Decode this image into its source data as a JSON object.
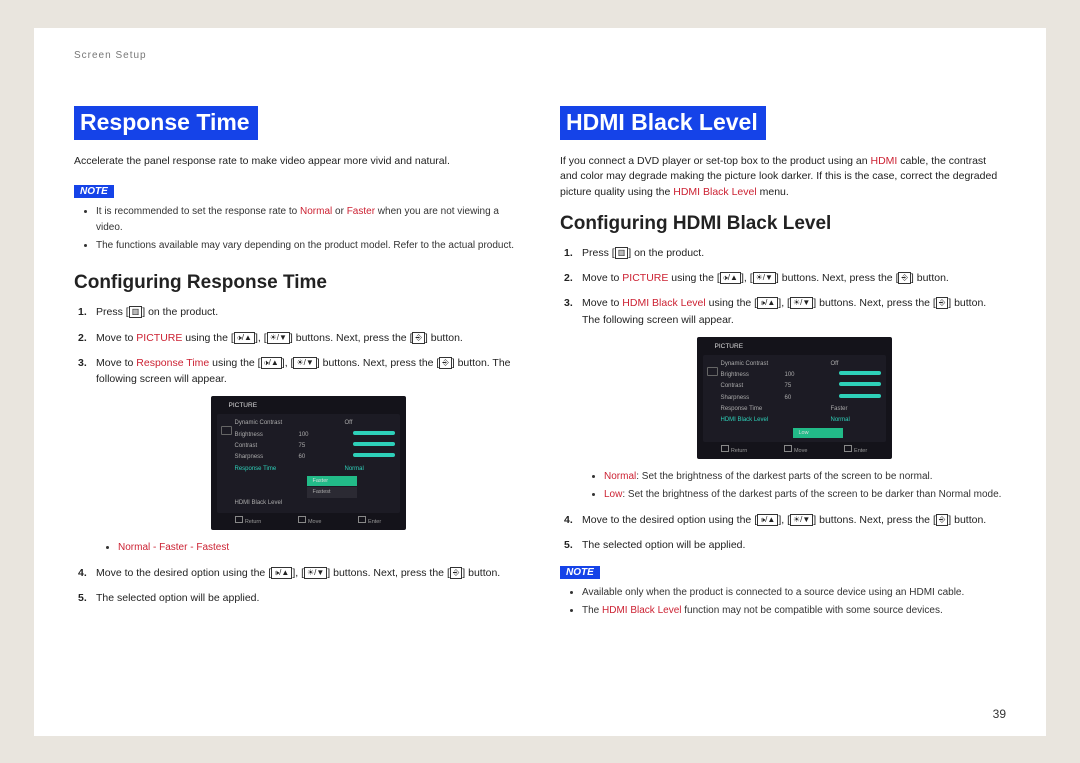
{
  "header": "Screen Setup",
  "pageNumber": "39",
  "left": {
    "title": "Response Time",
    "intro": "Accelerate the panel response rate to make video appear more vivid and natural.",
    "noteLabel": "NOTE",
    "notes": [
      "It is recommended to set the response rate to Normal or Faster when you are not viewing a video.",
      "The functions available may vary depending on the product model. Refer to the actual product."
    ],
    "note_hl_a": "Normal",
    "note_hl_b": "Faster",
    "subheading": "Configuring Response Time",
    "steps": {
      "s1a": "Press [",
      "s1b": "] on the product.",
      "s2a": "Move to ",
      "s2_hl": "PICTURE",
      "s2b": " using the [",
      "s2c": "], [",
      "s2d": "] buttons. Next, press the [",
      "s2e": "] button.",
      "s3a": "Move to ",
      "s3_hl": "Response Time",
      "s3b": " using the [",
      "s3c": "], [",
      "s3d": "] buttons. Next, press the [",
      "s3e": "] button. The following screen will appear.",
      "opts": "Normal - Faster - Fastest",
      "s4a": "Move to the desired option using the [",
      "s4b": "], [",
      "s4c": "] buttons. Next, press the [",
      "s4d": "] button.",
      "s5": "The selected option will be applied."
    },
    "osd": {
      "title": "PICTURE",
      "rows": [
        {
          "k": "Dynamic Contrast",
          "v": "Off"
        },
        {
          "k": "Brightness",
          "v": "100"
        },
        {
          "k": "Contrast",
          "v": "75"
        },
        {
          "k": "Sharpness",
          "v": "60"
        },
        {
          "k": "Response Time",
          "v": "Normal",
          "hl": true
        },
        {
          "k": "HDMI Black Level",
          "v": ""
        }
      ],
      "subopts": [
        "Faster",
        "Fastest"
      ],
      "foot": [
        "Return",
        "Move",
        "Enter"
      ]
    }
  },
  "right": {
    "title": "HDMI Black Level",
    "intro_a": "If you connect a DVD player or set-top box to the product using an ",
    "intro_hl1": "HDMI",
    "intro_b": " cable, the contrast and color may degrade making the picture look darker. If this is the case, correct the degraded picture quality using the ",
    "intro_hl2": "HDMI Black Level",
    "intro_c": " menu.",
    "subheading": "Configuring HDMI Black Level",
    "steps": {
      "s1a": "Press [",
      "s1b": "] on the product.",
      "s2a": "Move to ",
      "s2_hl": "PICTURE",
      "s2b": " using the [",
      "s2c": "], [",
      "s2d": "] buttons. Next, press the [",
      "s2e": "] button.",
      "s3a": "Move to ",
      "s3_hl": "HDMI Black Level",
      "s3b": " using the [",
      "s3c": "], [",
      "s3d": "] buttons. Next, press the [",
      "s3e": "] button. The following screen will appear.",
      "mid_n_hl": "Normal",
      "mid_n": ": Set the brightness of the darkest parts of the screen to be normal.",
      "mid_l_hl": "Low",
      "mid_l": ": Set the brightness of the darkest parts of the screen to be darker than Normal mode.",
      "s4a": "Move to the desired option using the [",
      "s4b": "], [",
      "s4c": "] buttons. Next, press the [",
      "s4d": "] button.",
      "s5": "The selected option will be applied."
    },
    "noteLabel": "NOTE",
    "notes": {
      "n1": "Available only when the product is connected to a source device using an HDMI cable.",
      "n2a": "The ",
      "n2_hl": "HDMI Black Level",
      "n2b": " function may not be compatible with some source devices."
    },
    "osd": {
      "title": "PICTURE",
      "rows": [
        {
          "k": "Dynamic Contrast",
          "v": "Off"
        },
        {
          "k": "Brightness",
          "v": "100"
        },
        {
          "k": "Contrast",
          "v": "75"
        },
        {
          "k": "Sharpness",
          "v": "60"
        },
        {
          "k": "Response Time",
          "v": "Faster"
        },
        {
          "k": "HDMI Black Level",
          "v": "Normal",
          "hl": true
        }
      ],
      "subopts": [
        "Low"
      ],
      "foot": [
        "Return",
        "Move",
        "Enter"
      ]
    }
  },
  "icons": {
    "menu": "▥",
    "volup": "🕩/▲",
    "voldn": "☀/▼",
    "enter": "⎆"
  }
}
